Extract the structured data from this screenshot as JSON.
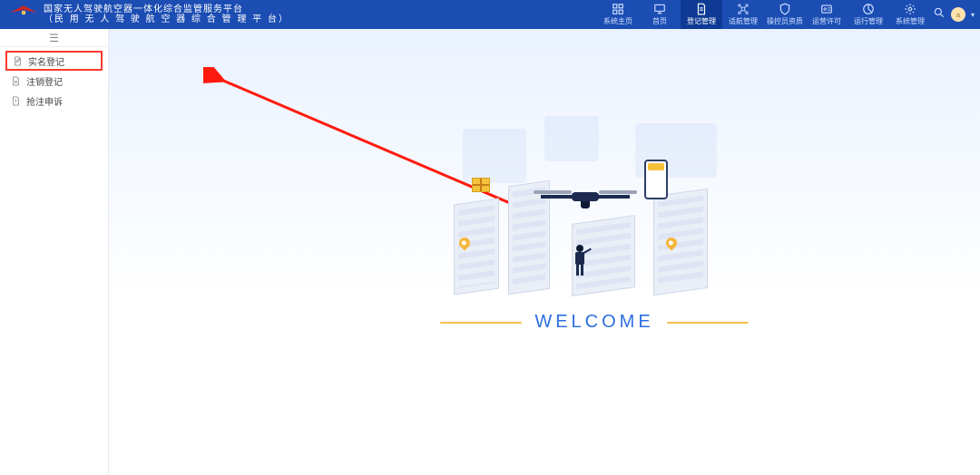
{
  "header": {
    "title_line1": "国家无人驾驶航空器一体化综合监管服务平台",
    "title_line2": "（民 用 无 人 驾 驶 航 空 器 综 合 管 理 平 台）",
    "nav": [
      {
        "label": "系统主页"
      },
      {
        "label": "首页"
      },
      {
        "label": "登记管理"
      },
      {
        "label": "适航管理"
      },
      {
        "label": "操控员资质"
      },
      {
        "label": "运营许可"
      },
      {
        "label": "运行管理"
      },
      {
        "label": "系统管理"
      }
    ],
    "active_nav_index": 2,
    "avatar_initial": "a"
  },
  "sidebar": {
    "items": [
      {
        "label": "实名登记"
      },
      {
        "label": "注销登记"
      },
      {
        "label": "抢注申诉"
      }
    ],
    "highlight_index": 0
  },
  "main": {
    "welcome": "WELCOME"
  }
}
